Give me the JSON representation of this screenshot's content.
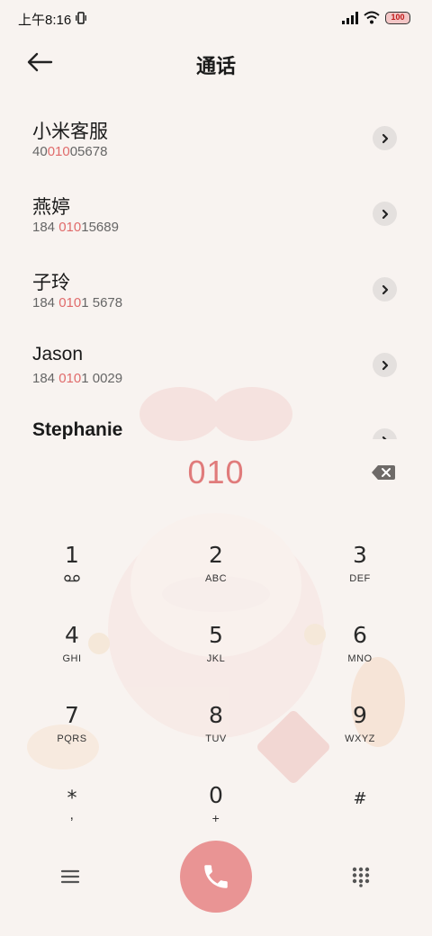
{
  "status_bar": {
    "time": "上午8:16",
    "battery": "100",
    "icons": [
      "vibrate-icon",
      "signal-icon",
      "wifi-icon",
      "battery-icon"
    ]
  },
  "header": {
    "title": "通话",
    "back_icon": "back-arrow-icon"
  },
  "contacts": [
    {
      "name": "小米客服",
      "number_pre": "40",
      "number_match": "010",
      "number_post": "05678"
    },
    {
      "name": "燕婷",
      "number_pre": "184 ",
      "number_match": "010",
      "number_post": "15689"
    },
    {
      "name": "子玲",
      "number_pre": "184 ",
      "number_match": "010",
      "number_post": "1 5678"
    },
    {
      "name": "Jason",
      "number_pre": "184 ",
      "number_match": "010",
      "number_post": "1 0029"
    },
    {
      "name": "Stephanie",
      "number_pre": "",
      "number_match": "",
      "number_post": ""
    }
  ],
  "dialer": {
    "entered_number": "010",
    "backspace_icon": "backspace-icon"
  },
  "keypad": [
    {
      "digit": "1",
      "letters": ""
    },
    {
      "digit": "2",
      "letters": "ABC"
    },
    {
      "digit": "3",
      "letters": "DEF"
    },
    {
      "digit": "4",
      "letters": "GHI"
    },
    {
      "digit": "5",
      "letters": "JKL"
    },
    {
      "digit": "6",
      "letters": "MNO"
    },
    {
      "digit": "7",
      "letters": "PQRS"
    },
    {
      "digit": "8",
      "letters": "TUV"
    },
    {
      "digit": "9",
      "letters": "WXYZ"
    },
    {
      "digit": "*",
      "letters": ","
    },
    {
      "digit": "0",
      "letters": "+"
    },
    {
      "digit": "#",
      "letters": ""
    }
  ],
  "bottom_bar": {
    "menu_icon": "menu-icon",
    "call_icon": "phone-icon",
    "keypad_icon": "dialpad-icon"
  },
  "colors": {
    "accent": "#e07b7b",
    "call_button": "#e99494",
    "background": "#f8f3f0"
  }
}
